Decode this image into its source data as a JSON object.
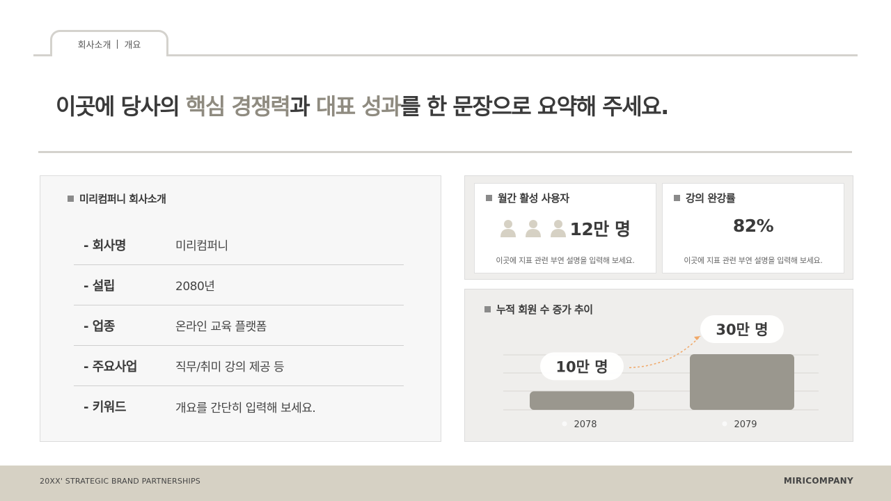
{
  "tab": {
    "section": "회사소개",
    "sub": "개요"
  },
  "headline": {
    "part1": "이곳에 당사의 ",
    "highlight1": "핵심 경쟁력",
    "part2": "과 ",
    "highlight2": "대표 성과",
    "part3": "를 한 문장으로 요약해 주세요."
  },
  "company": {
    "title": "미리컴퍼니 회사소개",
    "rows": [
      {
        "label": "- 회사명",
        "value": "미리컴퍼니"
      },
      {
        "label": "- 설립",
        "value": "2080년"
      },
      {
        "label": "- 업종",
        "value": "온라인 교육 플랫폼"
      },
      {
        "label": "- 주요사업",
        "value": "직무/취미 강의 제공 등"
      },
      {
        "label": "- 키워드",
        "value": "개요를 간단히 입력해 보세요."
      }
    ]
  },
  "metrics": [
    {
      "title": "월간 활성 사용자",
      "value": "12만 명",
      "icon": "person-icon",
      "desc": "이곳에 지표 관련 부연 설명을 입력해 보세요."
    },
    {
      "title": "강의 완강률",
      "value": "82%",
      "desc": "이곳에 지표 관련 부연 설명을 입력해 보세요."
    }
  ],
  "colors": {
    "accent": "#8f8b80",
    "bar": "#9a978e",
    "footer": "#d6d1c4",
    "arrow": "#f0a868"
  },
  "chart_data": {
    "type": "bar",
    "title": "누적 회원 수 증가 추이",
    "categories": [
      "2078",
      "2079"
    ],
    "values": [
      10,
      30
    ],
    "value_labels": [
      "10만 명",
      "30만 명"
    ],
    "unit": "만 명",
    "ylim": [
      0,
      30
    ],
    "grid": true
  },
  "footer": {
    "left": "20XX' STRATEGIC BRAND PARTNERSHIPS",
    "right": "MIRICOMPANY"
  }
}
